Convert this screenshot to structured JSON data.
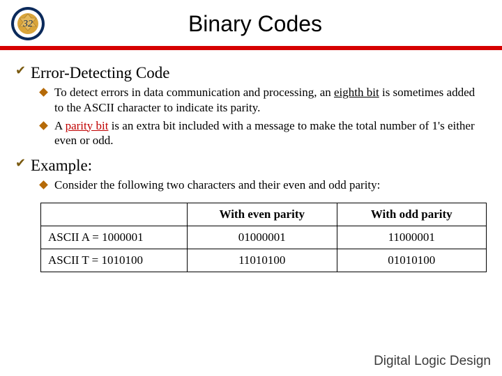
{
  "title": "Binary Codes",
  "logo_number": "32",
  "sections": [
    {
      "heading": "Error-Detecting Code",
      "items": [
        {
          "pre": "To detect errors in data communication and processing, an ",
          "u1": "eighth bit",
          "post": " is sometimes added to the ASCII character to indicate its parity."
        },
        {
          "pre": "A ",
          "red_u": "parity bit",
          "post": " is an extra bit included with a message to make the total number of 1's either even or odd."
        }
      ]
    },
    {
      "heading": "Example:",
      "items": [
        {
          "plain": "Consider the following two characters and their even and odd parity:"
        }
      ]
    }
  ],
  "table": {
    "col0_blank": "",
    "col1": "With even parity",
    "col2": "With odd parity",
    "rows": [
      {
        "label": "ASCII A = 1000001",
        "even": "01000001",
        "odd": "11000001"
      },
      {
        "label": "ASCII T = 1010100",
        "even": "11010100",
        "odd": "01010100"
      }
    ]
  },
  "footer": "Digital Logic Design"
}
